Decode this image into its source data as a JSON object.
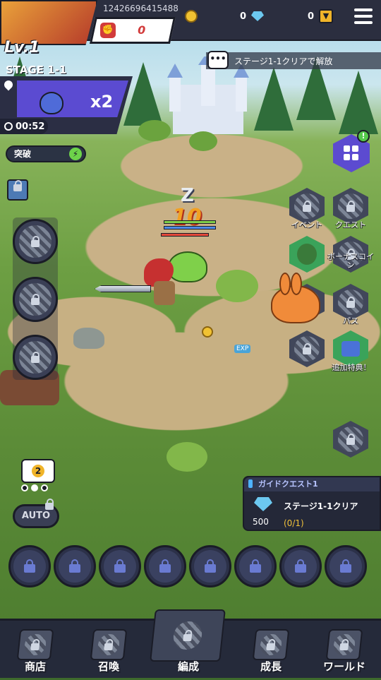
{
  "player": {
    "level": "Lv.1",
    "id": "12426696415488",
    "power": "0"
  },
  "currency": {
    "coins": "0",
    "gems": "0"
  },
  "stage": {
    "label": "STAGE 1-1",
    "multiplier": "x2",
    "timer": "00:52"
  },
  "unlock_notice": "ステージ1-1クリアで解放",
  "breakthrough_label": "突破",
  "battle": {
    "damage": "10",
    "sleep": "Z",
    "exp_label": "EXP"
  },
  "right_menu": [
    {
      "label": "イベント"
    },
    {
      "label": "クエスト"
    },
    {
      "label": "ボーナスコイン"
    },
    {
      "label": "パス"
    },
    {
      "label": "追加特典！"
    }
  ],
  "camera": {
    "count": "2"
  },
  "auto_label": "AUTO",
  "guide_quest": {
    "title": "ガイドクエスト1",
    "reward_amount": "500",
    "description": "ステージ1-1クリア",
    "progress": "(0/1)"
  },
  "nav": {
    "shop": "商店",
    "summon": "召喚",
    "formation": "編成",
    "growth": "成長",
    "world": "ワールド"
  },
  "colors": {
    "panel": "#2b2e3f",
    "accent_purple": "#5b4bd1",
    "gold": "#f0b429",
    "power_red": "#d23b3b"
  }
}
